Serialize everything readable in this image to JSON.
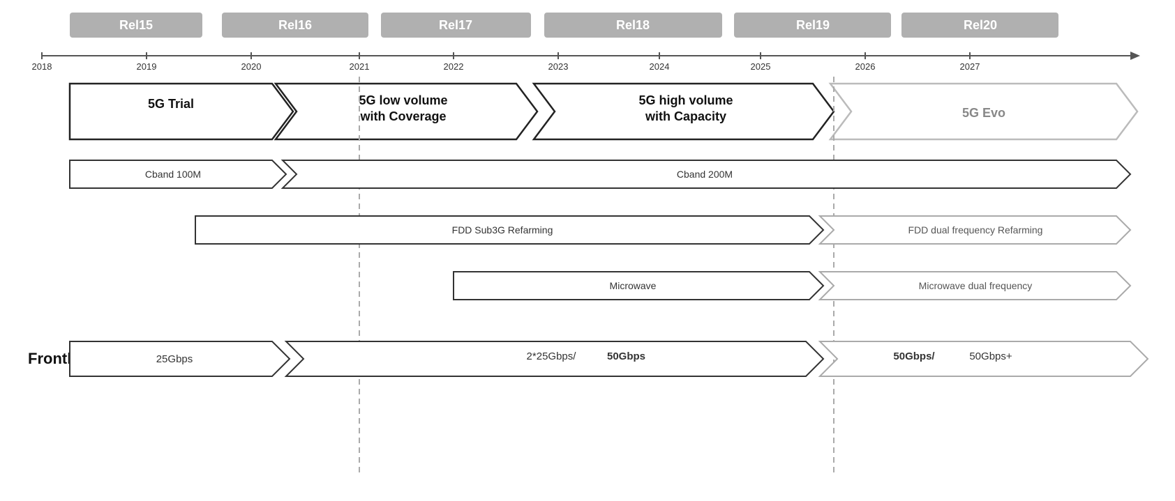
{
  "timeline": {
    "releases": [
      {
        "label": "Rel15",
        "x_start_pct": 0,
        "width_pct": 16
      },
      {
        "label": "Rel16",
        "x_start_pct": 18,
        "width_pct": 14
      },
      {
        "label": "Rel17",
        "x_start_pct": 34,
        "width_pct": 14
      },
      {
        "label": "Rel18",
        "x_start_pct": 50,
        "width_pct": 16
      },
      {
        "label": "Rel19",
        "x_start_pct": 68,
        "width_pct": 12
      },
      {
        "label": "Rel20",
        "x_start_pct": 82,
        "width_pct": 12
      }
    ],
    "years": [
      "2018",
      "2019",
      "2020",
      "2021",
      "2022",
      "2023",
      "2024",
      "2025",
      "2026",
      "2027"
    ]
  },
  "phases": [
    {
      "label": "5G Trial",
      "type": "first"
    },
    {
      "label": "5G low volume\nwith Coverage",
      "type": "middle"
    },
    {
      "label": "5G high volume\nwith Capacity",
      "type": "middle"
    },
    {
      "label": "5G Evo",
      "type": "last"
    }
  ],
  "rows": [
    {
      "items": [
        {
          "label": "Cband 100M",
          "type": "first",
          "span": 1
        },
        {
          "label": "Cband 200M",
          "type": "long",
          "span": 3
        }
      ]
    },
    {
      "items": [
        {
          "label": "FDD Sub3G Refarming",
          "type": "long-notched",
          "span": 3
        },
        {
          "label": "FDD dual frequency Refarming",
          "type": "notched-light",
          "span": 1
        }
      ]
    },
    {
      "items": [
        {
          "label": "Microwave",
          "type": "first",
          "span": 1
        },
        {
          "label": "Microwave dual frequency",
          "type": "notched-light",
          "span": 1
        }
      ]
    }
  ],
  "fronthaul": {
    "label": "Fronthaul",
    "items": [
      {
        "label": "25Gbps",
        "type": "first"
      },
      {
        "label": "2*25Gbps/50Gbps",
        "label_bold": "50Gbps",
        "type": "middle"
      },
      {
        "label": "50Gbps/ 50Gbps+",
        "label_bold": "50Gbps/",
        "type": "last"
      }
    ]
  }
}
